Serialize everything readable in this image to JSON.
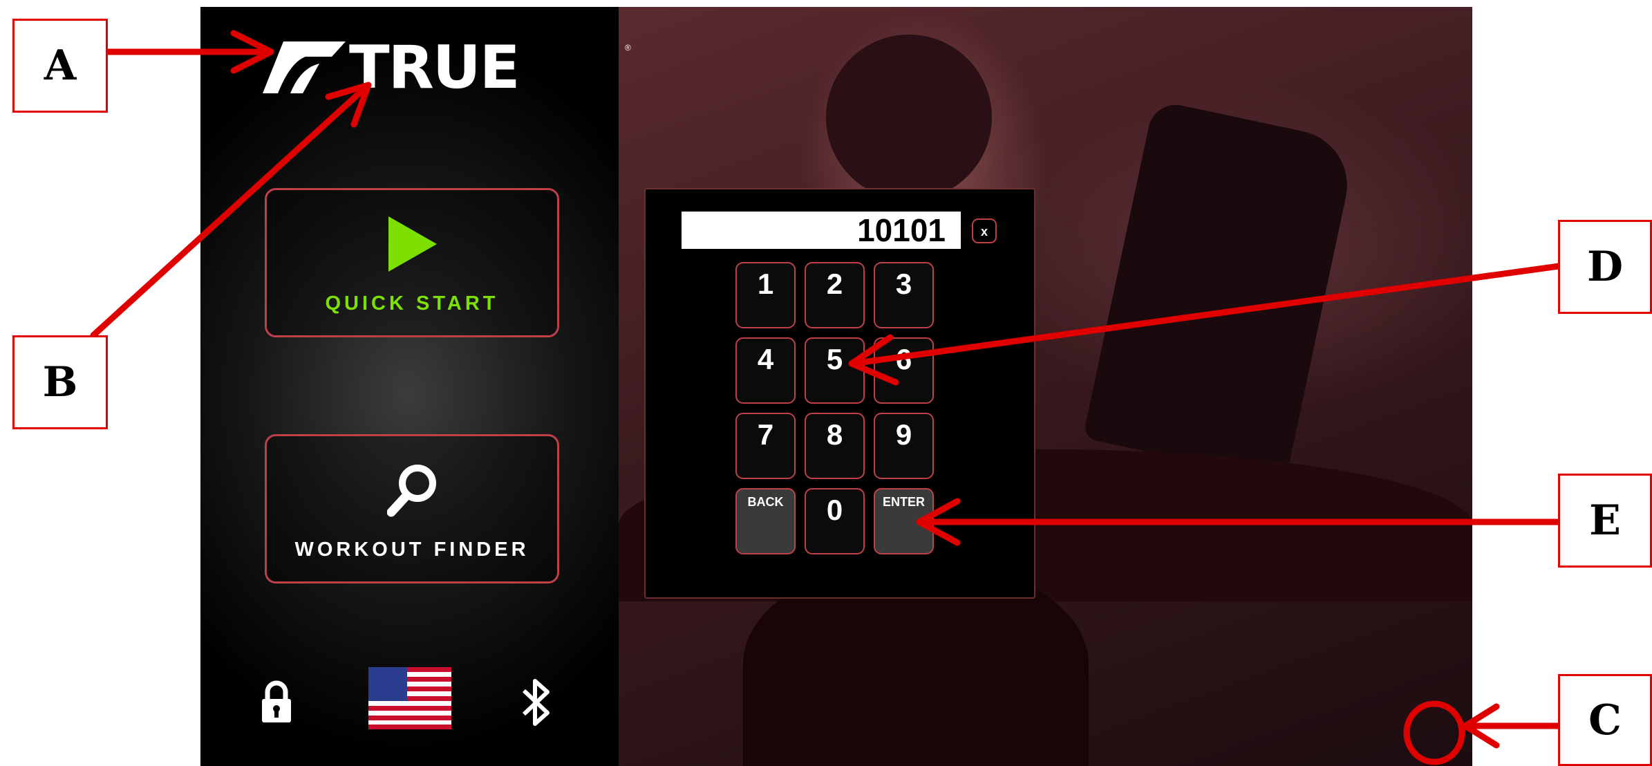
{
  "brand": {
    "logo_text": "TRUE",
    "registered": "®"
  },
  "sidebar": {
    "quick_start": {
      "label": "QUICK START",
      "icon": "play-icon",
      "icon_color": "#7de000"
    },
    "workout_finder": {
      "label": "WORKOUT FINDER",
      "icon": "search-icon"
    },
    "bottom": {
      "lock_icon": "lock-icon",
      "flag_icon": "us-flag-icon",
      "bluetooth_icon": "bluetooth-icon"
    }
  },
  "keypad": {
    "display_value": "10101",
    "clear_label": "x",
    "keys": [
      "1",
      "2",
      "3",
      "4",
      "5",
      "6",
      "7",
      "8",
      "9",
      "BACK",
      "0",
      "ENTER"
    ]
  },
  "callouts": {
    "a": "A",
    "b": "B",
    "c": "C",
    "d": "D",
    "e": "E"
  },
  "colors": {
    "accent_green": "#7de000",
    "button_border": "#c0404a",
    "callout_red": "#e00000"
  }
}
